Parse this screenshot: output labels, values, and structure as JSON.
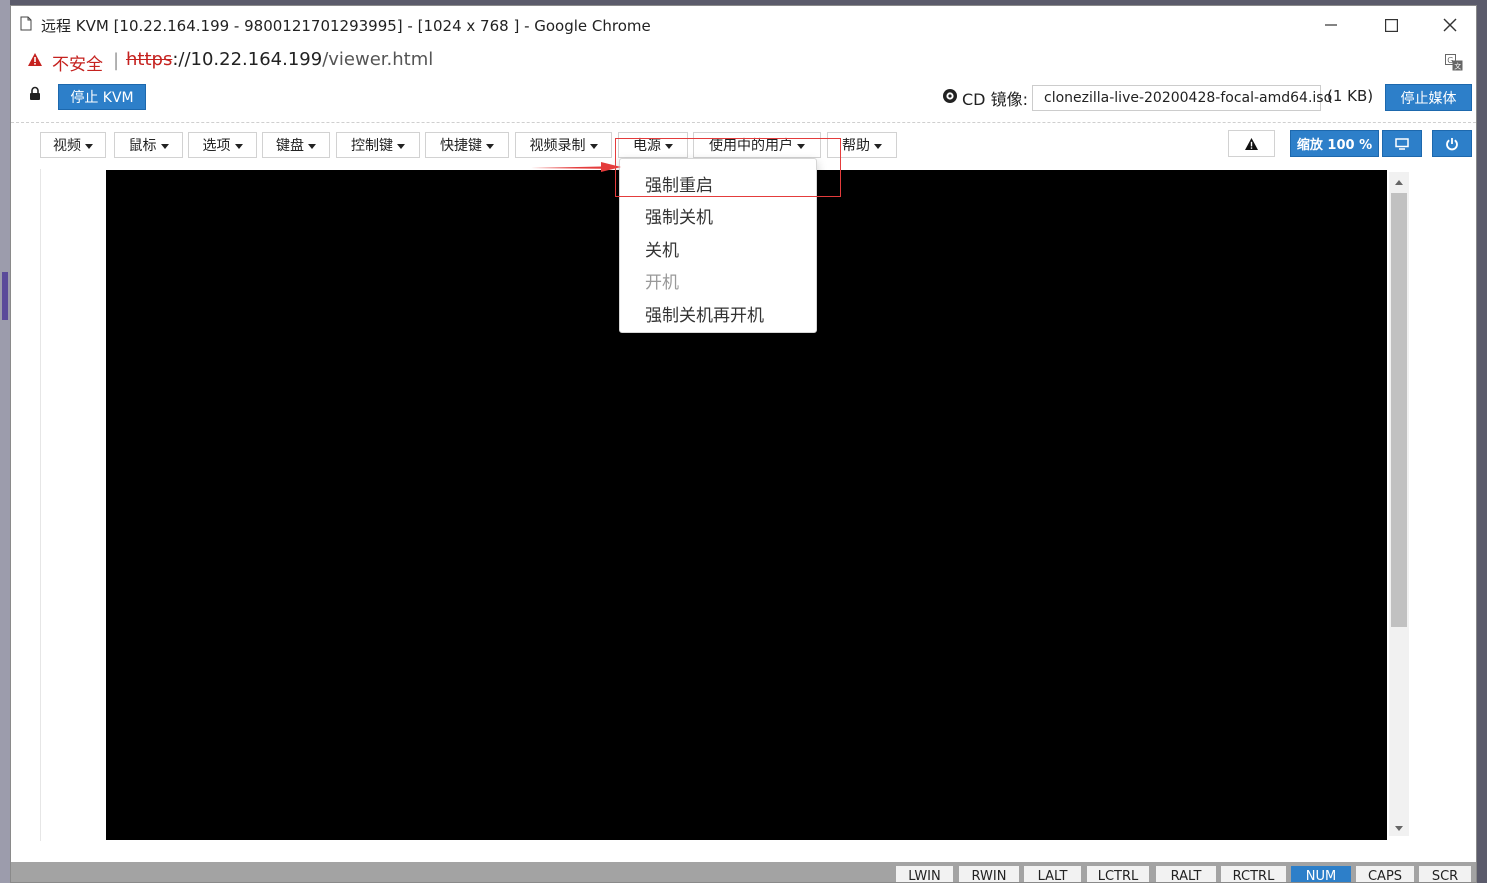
{
  "window": {
    "title": "远程 KVM [10.22.164.199 - 9800121701293995] - [1024 x 768 ] - Google Chrome",
    "minimize_icon": "minimize-icon",
    "maximize_icon": "maximize-icon",
    "close_icon": "close-icon"
  },
  "address_bar": {
    "security_label": "不安全",
    "separator": "|",
    "url_scheme": "https",
    "url_host": "://10.22.164.199",
    "url_path": "/viewer.html"
  },
  "toolbar": {
    "stop_kvm_label": "停止 KVM",
    "cd_label": "CD 镜像:",
    "cd_file": "clonezilla-live-20200428-focal-amd64.iso",
    "cd_size": "(1 KB)",
    "stop_media_label": "停止媒体"
  },
  "menubar": {
    "items": [
      "视频",
      "鼠标",
      "选项",
      "键盘",
      "控制键",
      "快捷键",
      "视频录制",
      "电源",
      "使用中的用户",
      "帮助"
    ],
    "zoom_label": "缩放 100 %"
  },
  "power_menu": {
    "items": [
      {
        "label": "强制重启",
        "enabled": true
      },
      {
        "label": "强制关机",
        "enabled": true
      },
      {
        "label": "关机",
        "enabled": true
      },
      {
        "label": "开机",
        "enabled": false
      },
      {
        "label": "强制关机再开机",
        "enabled": true
      }
    ]
  },
  "status_keys": [
    {
      "label": "LWIN",
      "active": false
    },
    {
      "label": "RWIN",
      "active": false
    },
    {
      "label": "LALT",
      "active": false
    },
    {
      "label": "LCTRL",
      "active": false
    },
    {
      "label": "RALT",
      "active": false
    },
    {
      "label": "RCTRL",
      "active": false
    },
    {
      "label": "NUM",
      "active": true
    },
    {
      "label": "CAPS",
      "active": false
    },
    {
      "label": "SCR",
      "active": false
    }
  ],
  "colors": {
    "accent_blue": "#2d7fc9",
    "annotation_red": "#e43c3c",
    "insecure_red": "#c5221f"
  }
}
